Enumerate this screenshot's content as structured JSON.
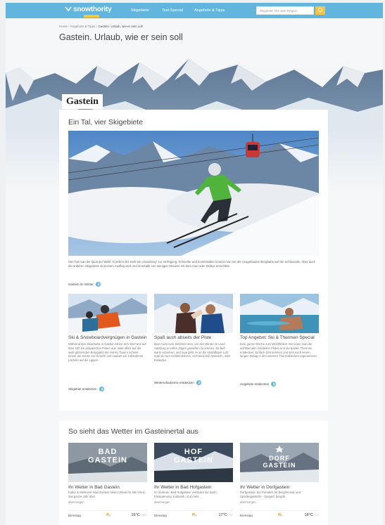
{
  "nav": {
    "logo": "snowthority",
    "links": [
      "Skigebiete",
      "Test-Special",
      "Angebote & Tipps"
    ],
    "search_placeholder": "Skigebiet, Ort oder Region"
  },
  "breadcrumb": {
    "home": "Home",
    "sep1": "›",
    "section": "Angebote & Tipps",
    "sep2": "›",
    "current": "Gastein. Urlaub, wie er sein soll"
  },
  "page_title": "Gastein. Urlaub, wie er sein soll",
  "region_tag": "Gastein",
  "main": {
    "title": "Ein Tal, vier Skigebiete",
    "intro": "Hier hat man die Qual der Wahl: In jedem Ort steht ein „Hausberg\" zur Verfügung. Schneller und komfortabler kommt man mit der neugebauten Bergbahn auf die Schlossalm. Aber auch die anderen Skigebiete sind einen Ausflug wert und innerhalb von wenigen Minuten mit dem Auto oder Skibus erreichbar.",
    "intro_link": "Gastein im Winter",
    "features": [
      {
        "title": "Ski & Snowboardvergnügen in Gastein",
        "text": "Während des Skiurlaubs in Gastein toben sich Ski-Fans auf über 200 km präparierten Pisten aus. Beim Blick auf die weiß glitzernden Berggipfel der Hohen Tauern scheint einem die Sonne ins Gesicht und zaubert ein zufriedenes Lächeln auf die Lippen.",
        "link": "Skigebiet entdecken"
      },
      {
        "title": "Spaß auch abseits der Piste",
        "text": "Man muss kein Skifahrer sein, um den Winter im Land Salzburg in vollen Zügen genießen zu können. Einfach warm anziehen, und raus geht es an die kristallklare Luft: egal ob zum Schlittenfahren, Schneeschuh Wandern, oder Eislaufen.",
        "link": "Winterurlaubsmix entdecken"
      },
      {
        "title": "Top Angebot: Ski & Thermen Special",
        "text": "Eine ganze Woche zum Wohlfühlen! Hier kann man die wohltuenden Gasteiner Pisten und die beiden Thermen entdecken. Einfach Zeit nehmen und sich nach einem langen Skitag in den warmen Thermalbecken regenerieren.",
        "link": "Angebote entdecken"
      }
    ]
  },
  "weather": {
    "title": "So sieht das Wetter im Gasteinertal aus",
    "places": [
      {
        "img_label_1": "BAD",
        "img_label_2": "GASTEIN",
        "title": "Ihr Wetter in Bad Gastein",
        "text": "Kultur & Wellness: Bad Gastein bietet Urlaub für alle Sinne, das ganze Jahr über.",
        "when": "übermorgen",
        "day": "Dienstag",
        "temp": "16°C",
        "temp_low": "/-10°C"
      },
      {
        "img_label_1": "HOF",
        "img_label_2": "GASTEIN",
        "title": "Ihr Wetter in Bad Hofgastein",
        "text": "Im Zentrum: Bad Hofgastein verbindet mit Sport, Entspannung, Kulinarik. Und mehr.",
        "when": "übermorgen",
        "day": "Dienstag",
        "temp": "17°C",
        "temp_low": "/-7°C"
      },
      {
        "img_label_1": "DORF",
        "img_label_2": "GASTEIN",
        "title": "Ihr Wetter in Dorfgastein",
        "text": "Dorfgastein: Ein Paradies für Bergfreunde und Sportbegeisterte - bergauf, bergab.",
        "when": "übermorgen",
        "day": "Dienstag",
        "temp": "18°C",
        "temp_low": "/-1°C"
      }
    ]
  },
  "colors": {
    "nav": "#62b6dd",
    "accent": "#f4c343",
    "link_icon": "#62b6dd"
  }
}
